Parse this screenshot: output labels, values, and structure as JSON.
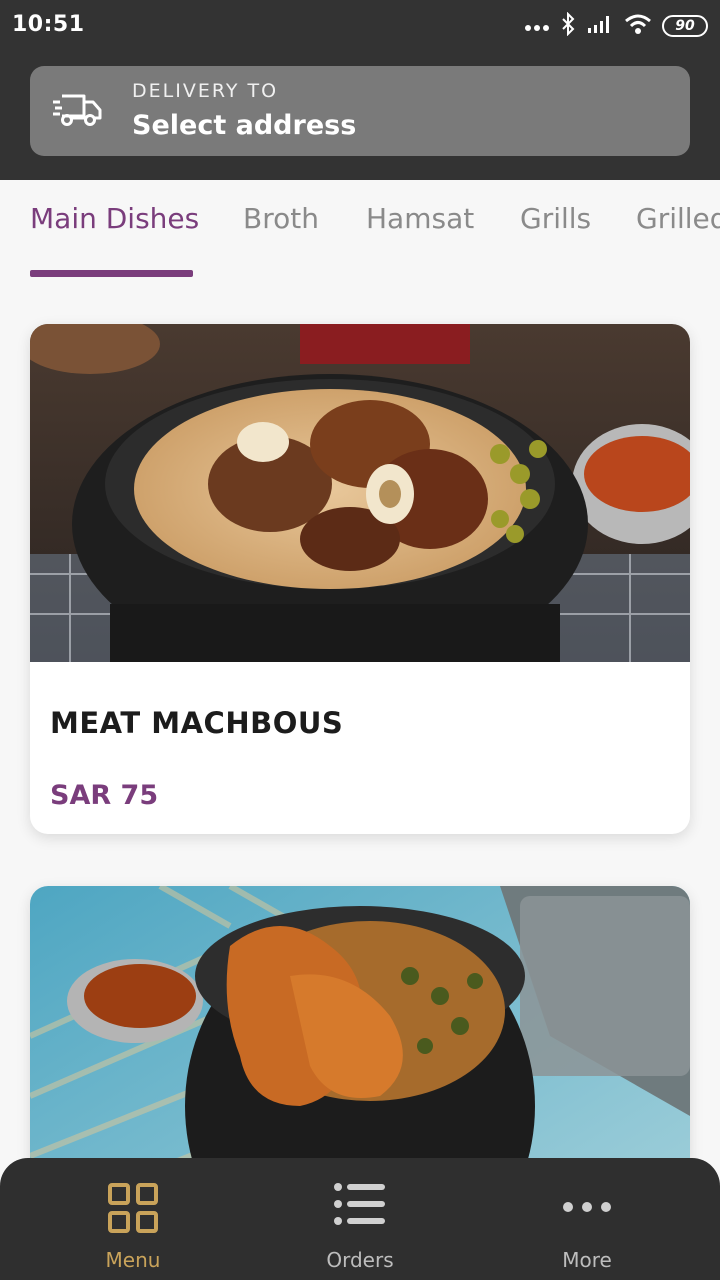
{
  "status_bar": {
    "time": "10:51",
    "battery": "90"
  },
  "delivery": {
    "label": "DELIVERY TO",
    "value": "Select address"
  },
  "tabs": [
    {
      "label": "Main Dishes",
      "active": true
    },
    {
      "label": "Broth"
    },
    {
      "label": "Hamsat"
    },
    {
      "label": "Grills"
    },
    {
      "label": "Grilled"
    }
  ],
  "items": [
    {
      "name": "MEAT MACHBOUS",
      "price": "SAR 75"
    },
    {
      "name": "",
      "price": ""
    }
  ],
  "bottom_nav": [
    {
      "label": "Menu",
      "icon": "grid-icon",
      "active": true
    },
    {
      "label": "Orders",
      "icon": "list-icon"
    },
    {
      "label": "More",
      "icon": "more-dots-icon"
    }
  ],
  "colors": {
    "accent": "#7a3d7c",
    "nav_active": "#c9a35a",
    "header_bg": "#333333"
  }
}
